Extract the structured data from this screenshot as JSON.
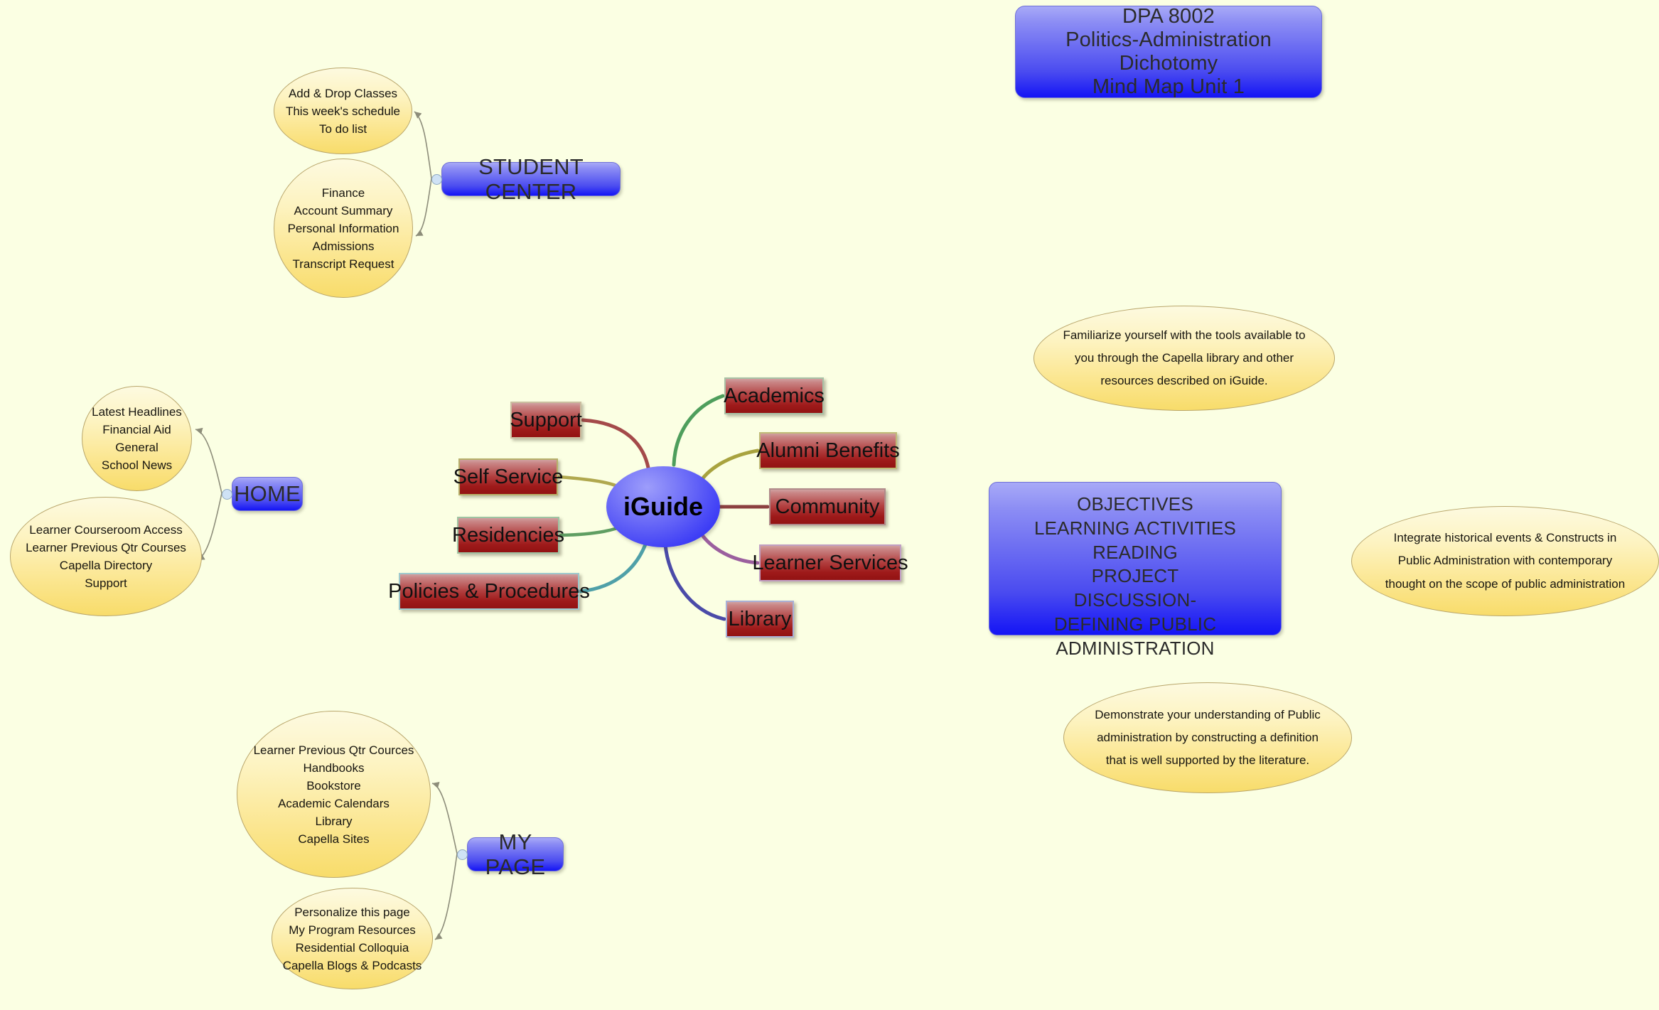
{
  "canvas": {
    "background": "#fbffe3"
  },
  "title": {
    "lines": [
      "DPA 8002",
      "Politics-Administration Dichotomy",
      "Mind Map Unit 1"
    ]
  },
  "objectives": {
    "lines": [
      "OBJECTIVES",
      "LEARNING ACTIVITIES",
      "READING",
      "PROJECT",
      "DISCUSSION-",
      "DEFINING PUBLIC ADMINISTRATION"
    ]
  },
  "center": {
    "label": "iGuide"
  },
  "branches": [
    {
      "label": "Support",
      "color": "#a44a4a"
    },
    {
      "label": "Self Service",
      "color": "#b0a84e"
    },
    {
      "label": "Residencies",
      "color": "#5f9e62"
    },
    {
      "label": "Policies & Procedures",
      "color": "#4fa0a8"
    },
    {
      "label": "Academics",
      "color": "#4e9e5c"
    },
    {
      "label": "Alumni Benefits",
      "color": "#a8a33f"
    },
    {
      "label": "Community",
      "color": "#8c4040"
    },
    {
      "label": "Learner Services",
      "color": "#9b5f9e"
    },
    {
      "label": "Library",
      "color": "#4b4ba8"
    }
  ],
  "student_center": {
    "label": "STUDENT CENTER",
    "group_1": [
      "Add & Drop Classes",
      "This week's schedule",
      "To do list"
    ],
    "group_2": [
      "Finance",
      "Account Summary",
      "Personal Information",
      "Admissions",
      "Transcript Request"
    ]
  },
  "home": {
    "label": "HOME",
    "group_1": [
      "Latest Headlines",
      "Financial Aid",
      "General",
      "School News"
    ],
    "group_2": [
      "Learner Courseroom Access",
      "Learner Previous Qtr Courses",
      "Capella Directory",
      "Support"
    ]
  },
  "my_page": {
    "label": "MY PAGE",
    "group_1": [
      "Learner Previous Qtr Cources",
      "Handbooks",
      "Bookstore",
      "Academic Calendars",
      "Library",
      "Capella Sites"
    ],
    "group_2": [
      "Personalize this page",
      "My Program Resources",
      "Residential Colloquia",
      "Capella Blogs & Podcasts"
    ]
  },
  "notes": [
    {
      "text": "Familiarize yourself with the tools available to you through the Capella library and other resources described on iGuide."
    },
    {
      "text": "Integrate historical events & Constructs in Public Administration with contemporary thought on the scope of public administration"
    },
    {
      "text": "Demonstrate your understanding of Public administration by constructing a definition that is well supported by the literature."
    }
  ]
}
